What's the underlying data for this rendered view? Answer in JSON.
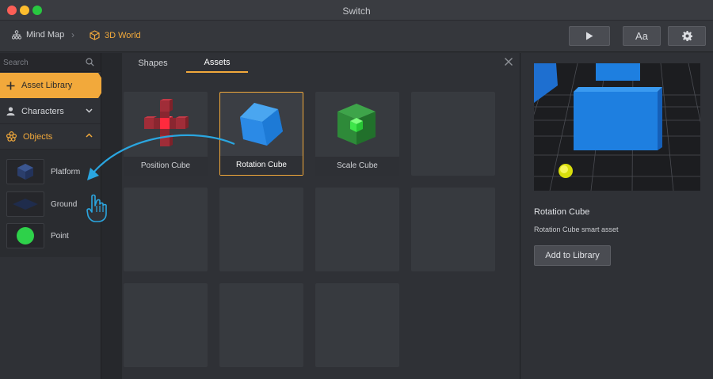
{
  "window": {
    "title": "Switch"
  },
  "breadcrumb": {
    "items": [
      {
        "label": "Mind Map",
        "icon": "mind-map-icon"
      },
      {
        "label": "3D World",
        "icon": "cube-icon"
      }
    ]
  },
  "toolbar": {
    "play_icon": "play-icon",
    "font_label": "Aa",
    "settings_icon": "gear-icon"
  },
  "sidebar": {
    "search_placeholder": "Search",
    "asset_library_label": "Asset Library",
    "characters_label": "Characters",
    "objects_label": "Objects",
    "objects": [
      {
        "label": "Platform"
      },
      {
        "label": "Ground"
      },
      {
        "label": "Point"
      }
    ]
  },
  "center": {
    "tabs": [
      {
        "label": "Shapes"
      },
      {
        "label": "Assets",
        "active": true
      }
    ],
    "tiles": [
      {
        "label": "Position Cube"
      },
      {
        "label": "Rotation Cube",
        "selected": true
      },
      {
        "label": "Scale Cube"
      }
    ]
  },
  "detail": {
    "title": "Rotation Cube",
    "description": "Rotation Cube smart asset",
    "add_button_label": "Add to Library"
  },
  "colors": {
    "accent": "#f2a93b",
    "drag_arrow": "#2aa6e0",
    "cube_blue": "#1e88e5"
  }
}
